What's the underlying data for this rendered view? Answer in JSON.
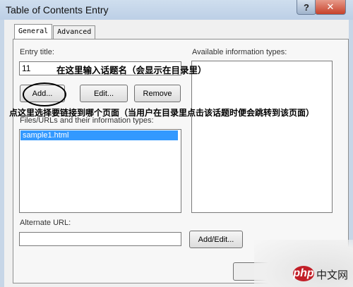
{
  "window": {
    "title": "Table of Contents Entry",
    "help_label": "?",
    "close_label": "✕"
  },
  "tabs": [
    {
      "label": "General",
      "active": true
    },
    {
      "label": "Advanced",
      "active": false
    }
  ],
  "general": {
    "entry_title_label": "Entry title:",
    "entry_title_value": "11",
    "available_types_label": "Available information types:",
    "add_button": "Add...",
    "edit_button": "Edit...",
    "remove_button": "Remove",
    "files_label": "Files/URLs and their information types:",
    "files": [
      "sample1.html"
    ],
    "alternate_url_label": "Alternate URL:",
    "alternate_url_value": "",
    "add_edit_button": "Add/Edit..."
  },
  "annotations": {
    "title_hint": "在这里输入话题名（会显示在目录里）",
    "link_hint": "点这里选择要链接到哪个页面（当用户在目录里点击该话题时便会跳转到该页面）"
  },
  "watermark": {
    "logo": "php",
    "site": "中文网"
  }
}
